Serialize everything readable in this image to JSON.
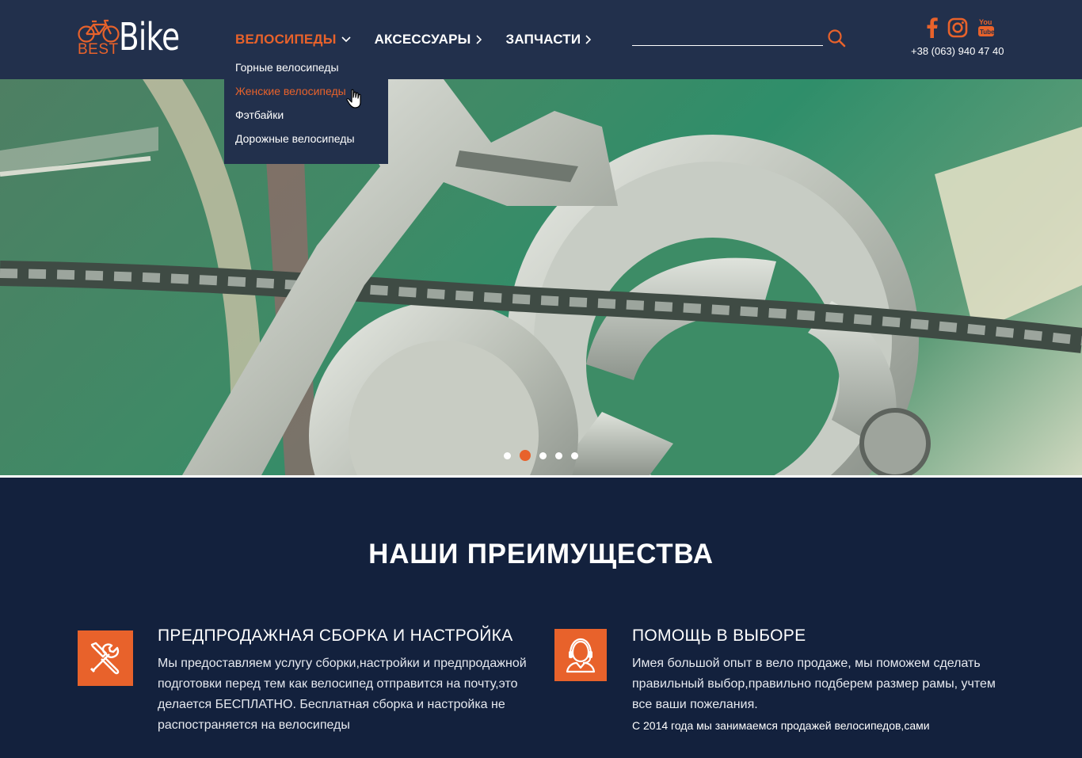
{
  "brand": {
    "best": "BEST",
    "bike": "Bike"
  },
  "nav": [
    {
      "label": "ВЕЛОСИПЕДЫ",
      "active": true
    },
    {
      "label": "АКСЕССУАРЫ",
      "active": false
    },
    {
      "label": "ЗАПЧАСТИ",
      "active": false
    }
  ],
  "dropdown": [
    "Горные велосипеды",
    "Женские велосипеды",
    "Фэтбайки",
    "Дорожные велосипеды"
  ],
  "search": {
    "placeholder": "",
    "value": ""
  },
  "social": {
    "icons": [
      "facebook-icon",
      "instagram-icon",
      "youtube-icon"
    ],
    "youtube_text": "You Tube"
  },
  "phone": "+38 (063) 940 47 40",
  "slider": {
    "total": 5,
    "active": 2
  },
  "advantages": {
    "title": "НАШИ ПРЕИМУЩЕСТВА",
    "items": [
      {
        "icon": "tools-icon",
        "title": "ПРЕДПРОДАЖНАЯ СБОРКА И НАСТРОЙКА",
        "text": "Мы предоставляем услугу сборки,настройки и предпродажной подготовки перед тем как велосипед отправится на почту,это делается БЕСПЛАТНО. Бесплатная сборка и настройка не распостраняется на велосипеды"
      },
      {
        "icon": "support-agent-icon",
        "title": "ПОМОЩЬ В ВЫБОРЕ",
        "text": "Имея большой опыт в вело продаже, мы поможем сделать правильный выбор,правильно подберем размер рамы, учтем все ваши пожелания.",
        "note": "С 2014 года мы занимаемся продажей велосипедов,сами"
      }
    ]
  },
  "colors": {
    "accent": "#e8622b",
    "header": "#22304c",
    "page": "#13213d"
  }
}
